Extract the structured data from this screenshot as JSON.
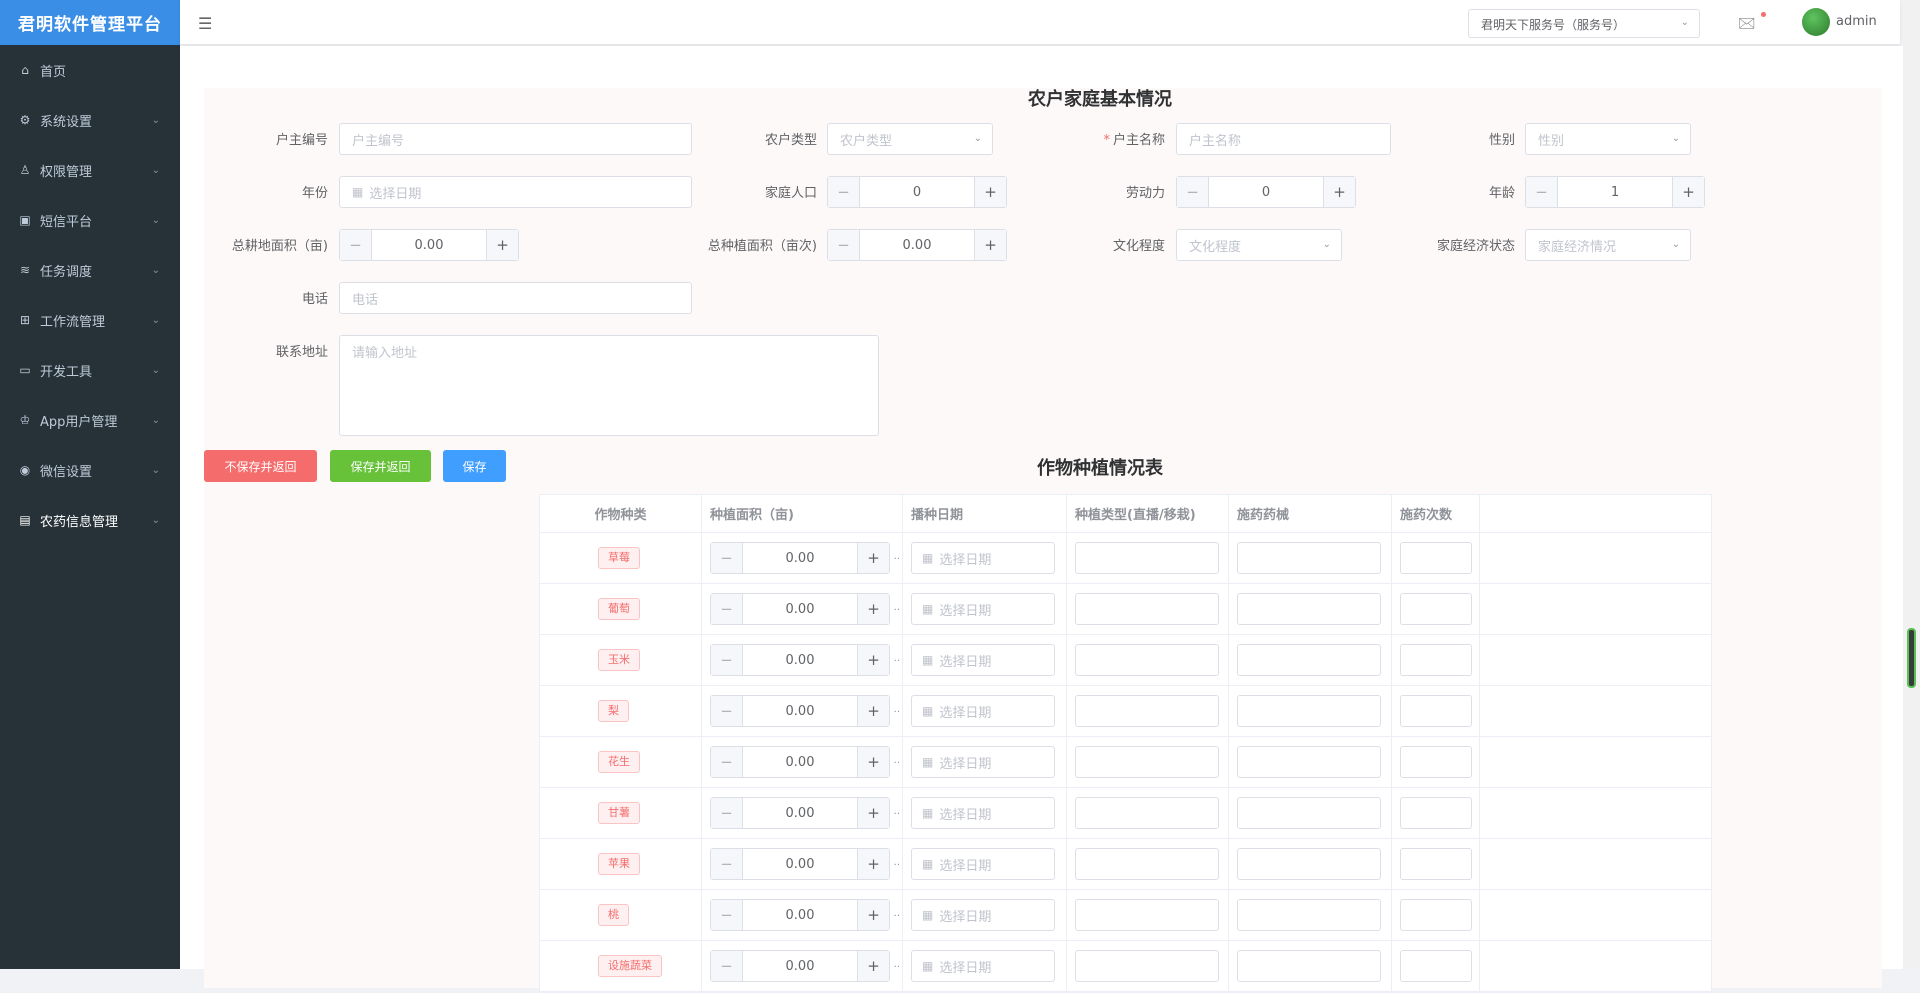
{
  "app": {
    "title": "君明软件管理平台"
  },
  "sidebar": {
    "items": [
      {
        "label": "首页",
        "icon": "home-icon"
      },
      {
        "label": "系统设置",
        "icon": "gear-icon"
      },
      {
        "label": "权限管理",
        "icon": "users-icon"
      },
      {
        "label": "短信平台",
        "icon": "message-icon"
      },
      {
        "label": "任务调度",
        "icon": "schedule-icon"
      },
      {
        "label": "工作流管理",
        "icon": "workflow-icon"
      },
      {
        "label": "开发工具",
        "icon": "monitor-icon"
      },
      {
        "label": "App用户管理",
        "icon": "crown-icon"
      },
      {
        "label": "微信设置",
        "icon": "wechat-icon"
      },
      {
        "label": "农药信息管理",
        "icon": "document-icon"
      }
    ]
  },
  "topbar": {
    "account_select": "君明天下服务号（服务号）",
    "username": "admin"
  },
  "form": {
    "title": "农户家庭基本情况",
    "household_no": {
      "label": "户主编号",
      "placeholder": "户主编号"
    },
    "farmer_type": {
      "label": "农户类型",
      "placeholder": "农户类型"
    },
    "householder_name": {
      "label": "户主名称",
      "placeholder": "户主名称",
      "required_mark": "*"
    },
    "gender": {
      "label": "性别",
      "placeholder": "性别"
    },
    "year": {
      "label": "年份",
      "placeholder": "选择日期"
    },
    "family_population": {
      "label": "家庭人口",
      "value": "0"
    },
    "labor_force": {
      "label": "劳动力",
      "value": "0"
    },
    "age": {
      "label": "年龄",
      "value": "1"
    },
    "total_farmland": {
      "label": "总耕地面积（亩)",
      "value": "0.00"
    },
    "total_planting": {
      "label": "总种植面积（亩次)",
      "value": "0.00"
    },
    "education": {
      "label": "文化程度",
      "placeholder": "文化程度"
    },
    "economic_status": {
      "label": "家庭经济状态",
      "placeholder": "家庭经济情况"
    },
    "phone": {
      "label": "电话",
      "placeholder": "电话"
    },
    "address": {
      "label": "联系地址",
      "placeholder": "请输入地址"
    }
  },
  "actions": {
    "discard_back": "不保存并返回",
    "save_back": "保存并返回",
    "save": "保存"
  },
  "crop_table": {
    "title": "作物种植情况表",
    "headers": [
      "作物种类",
      "种植面积（亩)",
      "播种日期",
      "种植类型(直播/移栽)",
      "施药药械",
      "施药次数"
    ],
    "date_placeholder": "选择日期",
    "rows": [
      {
        "crop": "草莓",
        "area": "0.00"
      },
      {
        "crop": "葡萄",
        "area": "0.00"
      },
      {
        "crop": "玉米",
        "area": "0.00"
      },
      {
        "crop": "梨",
        "area": "0.00"
      },
      {
        "crop": "花生",
        "area": "0.00"
      },
      {
        "crop": "甘薯",
        "area": "0.00"
      },
      {
        "crop": "苹果",
        "area": "0.00"
      },
      {
        "crop": "桃",
        "area": "0.00"
      },
      {
        "crop": "设施蔬菜",
        "area": "0.00"
      }
    ]
  },
  "colors": {
    "sidebar": "#263238",
    "logo": "#3a8ee6",
    "danger": "#f56c6c",
    "success": "#67c23a",
    "primary": "#409eff"
  }
}
